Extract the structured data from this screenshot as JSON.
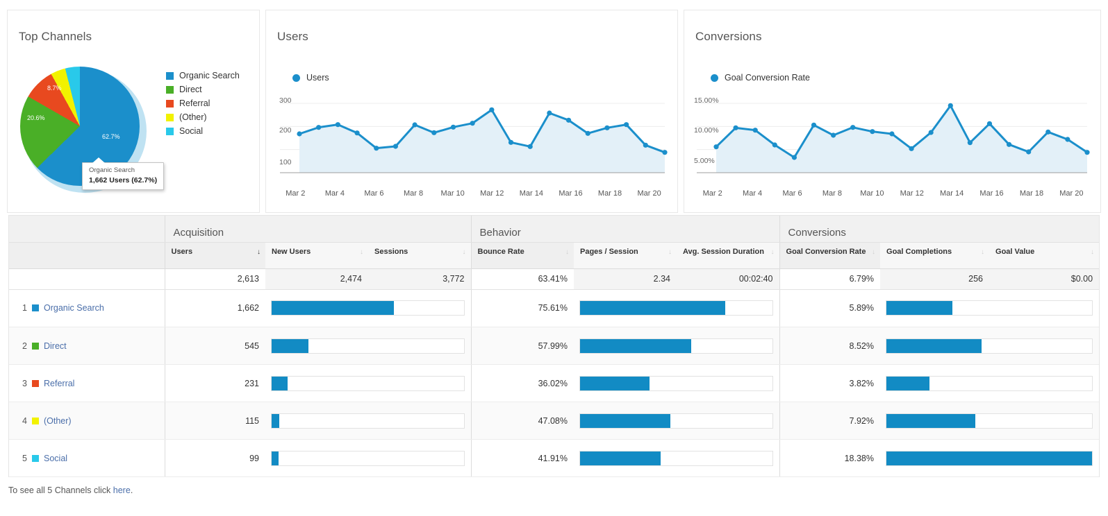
{
  "widgets": {
    "channels": {
      "title": "Top Channels",
      "legend": [
        {
          "label": "Organic Search",
          "color": "#1b8fcb"
        },
        {
          "label": "Direct",
          "color": "#4aaf27"
        },
        {
          "label": "Referral",
          "color": "#e8491f"
        },
        {
          "label": "(Other)",
          "color": "#f2f200"
        },
        {
          "label": "Social",
          "color": "#29c9ea"
        }
      ],
      "slice_labels": [
        "62.7%",
        "20.6%",
        "8.7%"
      ],
      "tooltip": {
        "title": "Organic Search",
        "value": "1,662 Users (62.7%)"
      }
    },
    "users": {
      "title": "Users",
      "legend_label": "Users",
      "y_ticks": [
        "300",
        "200",
        "100"
      ]
    },
    "conversions": {
      "title": "Conversions",
      "legend_label": "Goal Conversion Rate",
      "y_ticks": [
        "15.00%",
        "10.00%",
        "5.00%"
      ]
    }
  },
  "chart_data": [
    {
      "type": "pie",
      "title": "Top Channels",
      "categories": [
        "Organic Search",
        "Direct",
        "Referral",
        "(Other)",
        "Social"
      ],
      "values": [
        62.7,
        20.6,
        8.7,
        4.0,
        4.0
      ],
      "value_counts": [
        1662,
        545,
        231,
        115,
        99
      ],
      "colors": [
        "#1b8fcb",
        "#4aaf27",
        "#e8491f",
        "#f2f200",
        "#29c9ea"
      ],
      "labels_shown": [
        "62.7%",
        "20.6%",
        "8.7%"
      ],
      "legend_position": "right",
      "unit": "Users"
    },
    {
      "type": "area",
      "title": "Users",
      "xlabel": "",
      "ylabel": "Users",
      "ylim": [
        0,
        330
      ],
      "grid": true,
      "legend": [
        "Users"
      ],
      "x_tick_labels": [
        "Mar 2",
        "Mar 4",
        "Mar 6",
        "Mar 8",
        "Mar 10",
        "Mar 12",
        "Mar 14",
        "Mar 16",
        "Mar 18",
        "Mar 20"
      ],
      "x": [
        "Mar 1",
        "Mar 2",
        "Mar 3",
        "Mar 4",
        "Mar 5",
        "Mar 6",
        "Mar 7",
        "Mar 8",
        "Mar 9",
        "Mar 10",
        "Mar 11",
        "Mar 12",
        "Mar 13",
        "Mar 14",
        "Mar 15",
        "Mar 16",
        "Mar 17",
        "Mar 18",
        "Mar 19",
        "Mar 20"
      ],
      "values": [
        168,
        196,
        208,
        172,
        106,
        114,
        207,
        173,
        197,
        214,
        272,
        131,
        113,
        258,
        227,
        170,
        194,
        208,
        119,
        88
      ]
    },
    {
      "type": "area",
      "title": "Conversions",
      "xlabel": "",
      "ylabel": "Goal Conversion Rate",
      "ylim": [
        0,
        16.5
      ],
      "grid": true,
      "legend": [
        "Goal Conversion Rate"
      ],
      "x_tick_labels": [
        "Mar 2",
        "Mar 4",
        "Mar 6",
        "Mar 8",
        "Mar 10",
        "Mar 12",
        "Mar 14",
        "Mar 16",
        "Mar 18",
        "Mar 20"
      ],
      "x": [
        "Mar 1",
        "Mar 2",
        "Mar 3",
        "Mar 4",
        "Mar 5",
        "Mar 6",
        "Mar 7",
        "Mar 8",
        "Mar 9",
        "Mar 10",
        "Mar 11",
        "Mar 12",
        "Mar 13",
        "Mar 14",
        "Mar 15",
        "Mar 16",
        "Mar 17",
        "Mar 18",
        "Mar 19",
        "Mar 20"
      ],
      "values": [
        5.6,
        9.7,
        9.2,
        6.0,
        3.3,
        10.3,
        8.1,
        9.8,
        8.9,
        8.4,
        5.2,
        8.7,
        14.5,
        6.5,
        10.6,
        6.1,
        4.5,
        8.8,
        7.2,
        4.4
      ]
    }
  ],
  "table": {
    "groups": [
      {
        "label": "Acquisition",
        "span": 3
      },
      {
        "label": "Behavior",
        "span": 3
      },
      {
        "label": "Conversions",
        "span": 3
      }
    ],
    "columns": [
      {
        "label": "Users",
        "sorted": true
      },
      {
        "label": "New Users",
        "sorted": false
      },
      {
        "label": "Sessions",
        "sorted": false
      },
      {
        "label": "Bounce Rate",
        "sorted": false
      },
      {
        "label": "Pages / Session",
        "sorted": false
      },
      {
        "label": "Avg. Session Duration",
        "sorted": false
      },
      {
        "label": "Goal Conversion Rate",
        "sorted": false
      },
      {
        "label": "Goal Completions",
        "sorted": false
      },
      {
        "label": "Goal Value",
        "sorted": false
      }
    ],
    "summary": [
      "2,613",
      "2,474",
      "3,772",
      "63.41%",
      "2.34",
      "00:02:40",
      "6.79%",
      "256",
      "$0.00"
    ],
    "rows": [
      {
        "index": "1",
        "name": "Organic Search",
        "color": "#1b8fcb",
        "users": "1,662",
        "users_pct": 63.6,
        "bounce_rate": "75.61%",
        "bounce_pct": 75.61,
        "goal_rate": "5.89%",
        "goal_pct": 32.0
      },
      {
        "index": "2",
        "name": "Direct",
        "color": "#4aaf27",
        "users": "545",
        "users_pct": 19.1,
        "bounce_rate": "57.99%",
        "bounce_pct": 57.99,
        "goal_pct": 46.4,
        "goal_rate": "8.52%"
      },
      {
        "index": "3",
        "name": "Referral",
        "color": "#e8491f",
        "users": "231",
        "users_pct": 8.2,
        "bounce_rate": "36.02%",
        "bounce_pct": 36.02,
        "goal_rate": "3.82%",
        "goal_pct": 20.8
      },
      {
        "index": "4",
        "name": "(Other)",
        "color": "#f2f200",
        "users": "115",
        "users_pct": 4.1,
        "bounce_rate": "47.08%",
        "bounce_pct": 47.08,
        "goal_rate": "7.92%",
        "goal_pct": 43.1
      },
      {
        "index": "5",
        "name": "Social",
        "color": "#29c9ea",
        "users": "99",
        "users_pct": 3.5,
        "bounce_rate": "41.91%",
        "bounce_pct": 41.91,
        "goal_rate": "18.38%",
        "goal_pct": 100.0
      }
    ]
  },
  "footer": {
    "prefix": "To see all 5 Channels click ",
    "link": "here",
    "suffix": "."
  }
}
